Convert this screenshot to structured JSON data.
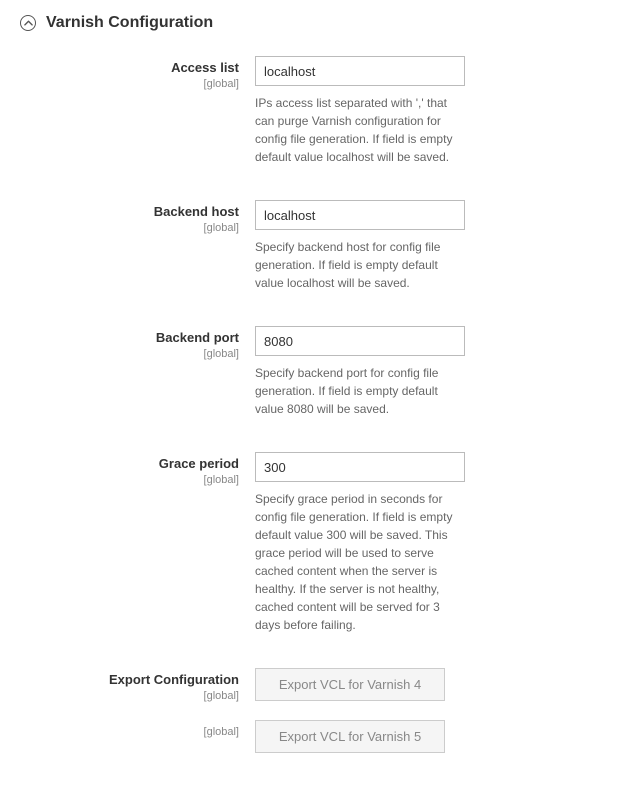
{
  "section": {
    "title": "Varnish Configuration"
  },
  "fields": {
    "access_list": {
      "label": "Access list",
      "scope": "[global]",
      "value": "localhost",
      "help": "IPs access list separated with ',' that can purge Varnish configuration for config file generation. If field is empty default value localhost will be saved."
    },
    "backend_host": {
      "label": "Backend host",
      "scope": "[global]",
      "value": "localhost",
      "help": "Specify backend host for config file generation. If field is empty default value localhost will be saved."
    },
    "backend_port": {
      "label": "Backend port",
      "scope": "[global]",
      "value": "8080",
      "help": "Specify backend port for config file generation. If field is empty default value 8080 will be saved."
    },
    "grace_period": {
      "label": "Grace period",
      "scope": "[global]",
      "value": "300",
      "help": "Specify grace period in seconds for config file generation. If field is empty default value 300 will be saved. This grace period will be used to serve cached content when the server is healthy. If the server is not healthy, cached content will be served for 3 days before failing."
    },
    "export_config": {
      "label": "Export Configuration",
      "scope": "[global]",
      "button4": "Export VCL for Varnish 4"
    },
    "export_config5": {
      "scope": "[global]",
      "button5": "Export VCL for Varnish 5"
    }
  }
}
